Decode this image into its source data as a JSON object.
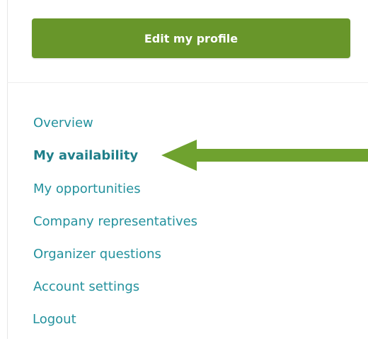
{
  "profile": {
    "edit_button_label": "Edit my profile"
  },
  "nav": {
    "items": [
      {
        "label": "Overview",
        "active": false
      },
      {
        "label": "My availability",
        "active": true
      },
      {
        "label": "My opportunities",
        "active": false
      },
      {
        "label": "Company representatives",
        "active": false
      },
      {
        "label": "Organizer questions",
        "active": false
      },
      {
        "label": "Account settings",
        "active": false
      },
      {
        "label": "Logout",
        "active": false
      }
    ]
  },
  "annotation": {
    "arrow_icon": "left-arrow-icon",
    "arrow_color": "#6fa22f"
  },
  "colors": {
    "button_green": "#68962a",
    "link_teal": "#23919d"
  }
}
